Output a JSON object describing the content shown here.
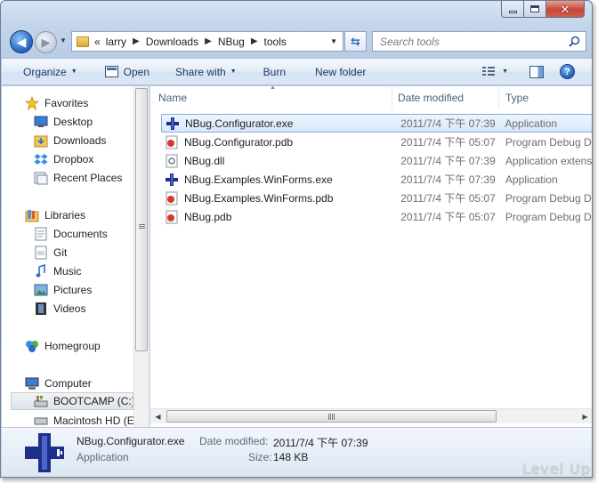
{
  "address": {
    "overflow_glyph": "«",
    "crumbs": [
      "larry",
      "Downloads",
      "NBug",
      "tools"
    ]
  },
  "search": {
    "placeholder": "Search tools"
  },
  "toolbar": {
    "organize": "Organize",
    "open": "Open",
    "share_with": "Share with",
    "burn": "Burn",
    "new_folder": "New folder"
  },
  "nav": {
    "favorites": "Favorites",
    "desktop": "Desktop",
    "downloads": "Downloads",
    "dropbox": "Dropbox",
    "recent_places": "Recent Places",
    "libraries": "Libraries",
    "documents": "Documents",
    "git": "Git",
    "music": "Music",
    "pictures": "Pictures",
    "videos": "Videos",
    "homegroup": "Homegroup",
    "computer": "Computer",
    "bootcamp": "BOOTCAMP (C:)",
    "macintosh": "Macintosh HD (E"
  },
  "columns": {
    "name": "Name",
    "date": "Date modified",
    "type": "Type"
  },
  "files": [
    {
      "name": "NBug.Configurator.exe",
      "date": "2011/7/4 下午 07:39",
      "type": "Application",
      "icon": "app-exe-icon"
    },
    {
      "name": "NBug.Configurator.pdb",
      "date": "2011/7/4 下午 05:07",
      "type": "Program Debug D",
      "icon": "pdb-file-icon"
    },
    {
      "name": "NBug.dll",
      "date": "2011/7/4 下午 07:39",
      "type": "Application extens",
      "icon": "dll-file-icon"
    },
    {
      "name": "NBug.Examples.WinForms.exe",
      "date": "2011/7/4 下午 07:39",
      "type": "Application",
      "icon": "app-exe-icon"
    },
    {
      "name": "NBug.Examples.WinForms.pdb",
      "date": "2011/7/4 下午 05:07",
      "type": "Program Debug D",
      "icon": "pdb-file-icon"
    },
    {
      "name": "NBug.pdb",
      "date": "2011/7/4 下午 05:07",
      "type": "Program Debug D",
      "icon": "pdb-file-icon"
    }
  ],
  "details": {
    "name": "NBug.Configurator.exe",
    "kind": "Application",
    "date_label": "Date modified:",
    "date_value": "2011/7/4 下午 07:39",
    "size_label": "Size:",
    "size_value": "148 KB"
  },
  "watermark": "Level Up",
  "colors": {
    "selection_border": "#84acdd",
    "selection_fill": "#d8e8fa",
    "toolbar_text": "#1e3a66",
    "caption_close": "#c7463a"
  }
}
